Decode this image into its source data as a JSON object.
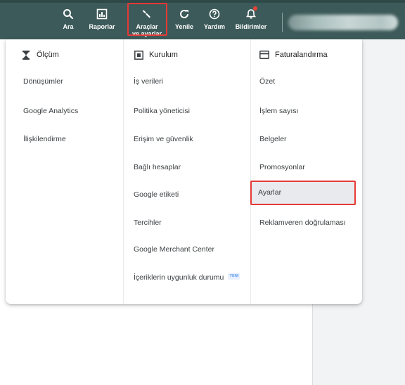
{
  "toolbar": {
    "search_label": "Ara",
    "reports_label": "Raporlar",
    "tools_label_line1": "Araçlar",
    "tools_label_line2": "ve ayarlar",
    "refresh_label": "Yenile",
    "help_label": "Yardım",
    "notifications_label": "Bildirimler"
  },
  "menu": {
    "columns": [
      {
        "header": "Ölçüm",
        "icon": "hourglass-icon",
        "items": [
          "Dönüşümler",
          "Google Analytics",
          "İlişkilendirme"
        ]
      },
      {
        "header": "Kurulum",
        "icon": "setup-box-icon",
        "items": [
          "İş verileri",
          "Politika yöneticisi",
          "Erişim ve güvenlik",
          "Bağlı hesaplar",
          "Google etiketi",
          "Tercihler",
          "Google Merchant Center",
          "İçeriklerin uygunluk durumu"
        ],
        "new_badge": "YENİ"
      },
      {
        "header": "Faturalandırma",
        "icon": "credit-card-icon",
        "items": [
          "Özet",
          "İşlem sayısı",
          "Belgeler",
          "Promosyonlar",
          "Ayarlar",
          "Reklamveren doğrulaması"
        ],
        "selected": "Ayarlar"
      }
    ]
  },
  "colors": {
    "toolbar": "#3c5a59",
    "highlight": "#e53935",
    "selected_bg": "#e8eaed"
  }
}
